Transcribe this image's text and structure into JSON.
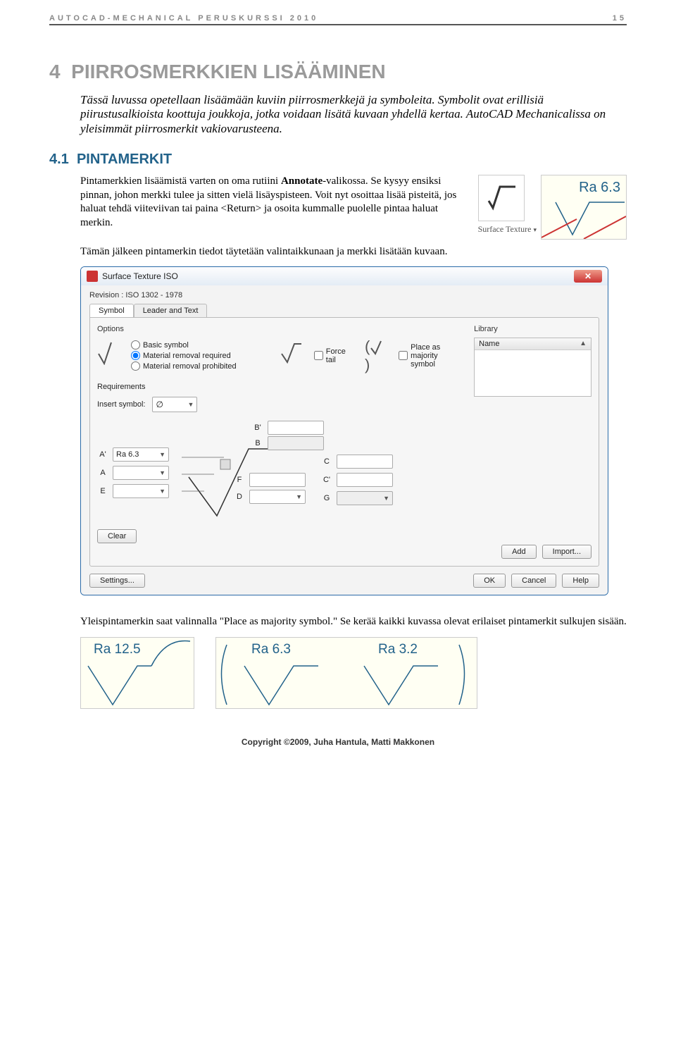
{
  "header": {
    "title": "AUTOCAD-MECHANICAL PERUSKURSSI 2010",
    "page": "15"
  },
  "chapter": {
    "num": "4",
    "title": "PIIRROSMERKKIEN LISÄÄMINEN"
  },
  "intro": "Tässä luvussa opetellaan lisäämään kuviin piirrosmerkkejä ja symboleita. Symbolit ovat erillisiä piirustusalkioista koottuja joukkoja, jotka voidaan lisätä kuvaan yhdellä kertaa. AutoCAD Mechanicalissa on yleisimmät piirrosmerkit vakiovarusteena.",
  "section": {
    "num": "4.1",
    "title": "PINTAMERKIT"
  },
  "para1_pre": "Pintamerkkien lisäämistä varten on oma rutiini ",
  "para1_bold": "Annotate",
  "para1_post": "-valikossa. Se kysyy ensiksi pinnan, johon merkki tulee ja sitten vielä lisäyspisteen. Voit nyt osoittaa lisää pisteitä, jos haluat tehdä viiteviivan tai paina <Return> ja osoita kummalle puolelle pintaa haluat merkin.",
  "para2": "Tämän jälkeen pintamerkin tiedot täytetään valintaikkunaan ja merkki lisätään kuvaan.",
  "fig1": {
    "surface_caption": "Surface Texture",
    "ra": "Ra 6.3"
  },
  "dialog": {
    "title": "Surface Texture ISO",
    "revision": "Revision : ISO 1302 - 1978",
    "tabs": {
      "symbol": "Symbol",
      "leader": "Leader and Text"
    },
    "options_label": "Options",
    "library_label": "Library",
    "library_col": "Name",
    "radios": {
      "basic": "Basic symbol",
      "required": "Material removal required",
      "prohibited": "Material removal prohibited"
    },
    "force_tail": "Force tail",
    "majority": "Place as majority symbol",
    "requirements": "Requirements",
    "insert_symbol": "Insert symbol:",
    "insert_value": "∅",
    "fields": {
      "Aprime": "A'",
      "A": "A",
      "E": "E",
      "Bprime": "B'",
      "B": "B",
      "F": "F",
      "D": "D",
      "C": "C",
      "Cprime": "C'",
      "G": "G",
      "Aprime_val": "Ra 6.3"
    },
    "buttons": {
      "clear": "Clear",
      "add": "Add",
      "import": "Import...",
      "settings": "Settings...",
      "ok": "OK",
      "cancel": "Cancel",
      "help": "Help"
    }
  },
  "bottom": "Yleispintamerkin saat valinnalla \"Place as majority symbol.\" Se kerää kaikki kuvassa olevat erilaiset pintamerkit sulkujen sisään.",
  "bottom_labels": {
    "a": "Ra 12.5",
    "b": "Ra 6.3",
    "c": "Ra 3.2"
  },
  "footer": "Copyright ©2009, Juha Hantula, Matti Makkonen"
}
